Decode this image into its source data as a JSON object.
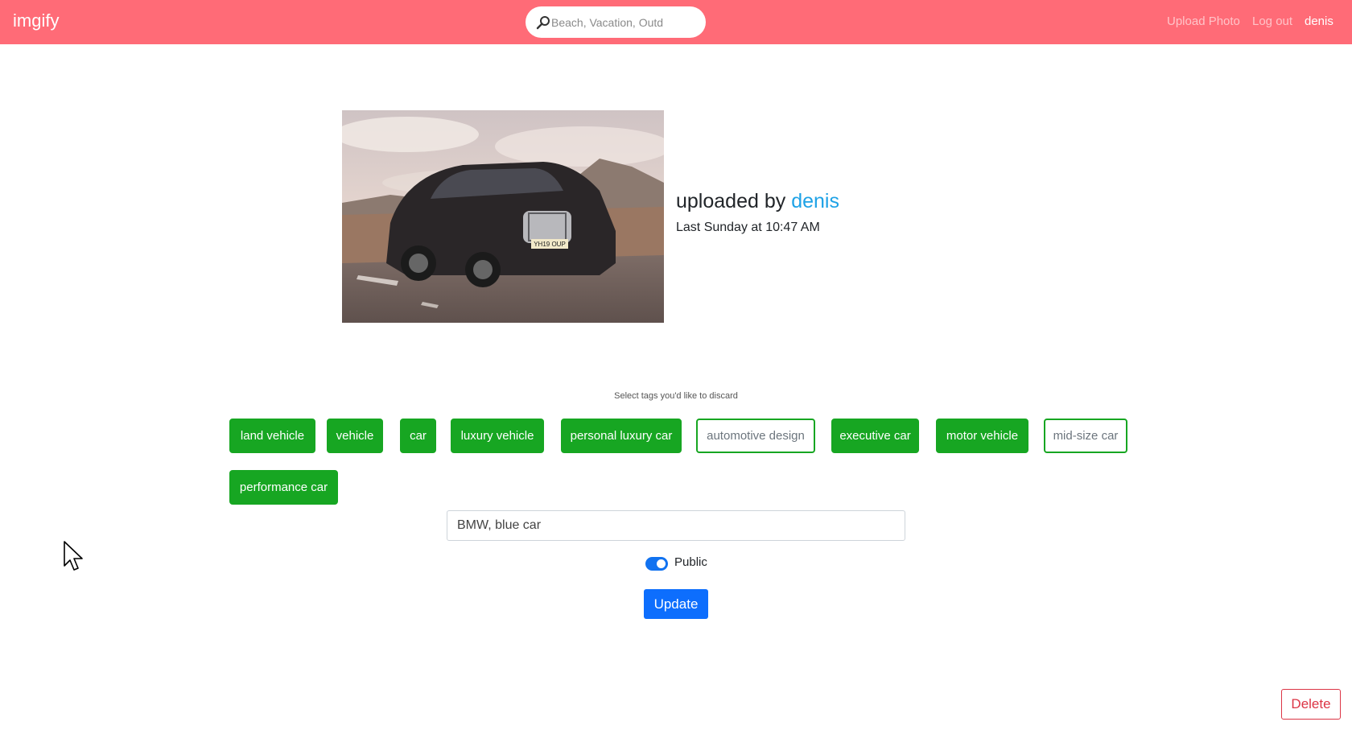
{
  "navbar": {
    "brand": "imgify",
    "search_placeholder": "Beach, Vacation, Outd",
    "upload_label": "Upload Photo",
    "logout_label": "Log out",
    "user_label": "denis"
  },
  "photo": {
    "plate_text": "YH19 OUP"
  },
  "info": {
    "uploaded_prefix": "uploaded by ",
    "uploader": "denis",
    "time": "Last Sunday at 10:47 AM"
  },
  "tags": {
    "label": "Select tags you'd like to discard",
    "items": [
      {
        "label": "land vehicle",
        "selected": true
      },
      {
        "label": "vehicle",
        "selected": true
      },
      {
        "label": "car",
        "selected": true
      },
      {
        "label": "luxury vehicle",
        "selected": true
      },
      {
        "label": "personal luxury car",
        "selected": true
      },
      {
        "label": "automotive design",
        "selected": false
      },
      {
        "label": "executive car",
        "selected": true
      },
      {
        "label": "motor vehicle",
        "selected": true
      },
      {
        "label": "mid-size car",
        "selected": false
      },
      {
        "label": "performance car",
        "selected": true
      }
    ]
  },
  "form": {
    "custom_tags_value": "BMW, blue car",
    "public_label": "Public",
    "public_enabled": true,
    "update_label": "Update",
    "delete_label": "Delete"
  },
  "colors": {
    "navbar": "#ff6b77",
    "tag_green": "#17a622",
    "link_blue": "#1ea2e6",
    "primary": "#0d6efd",
    "danger": "#dc3545"
  }
}
